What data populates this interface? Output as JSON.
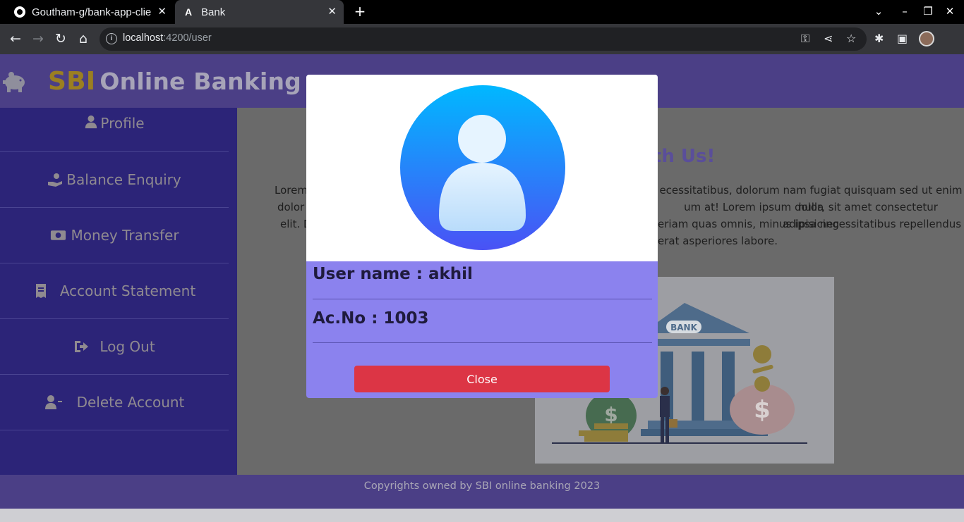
{
  "browser": {
    "tabs": [
      {
        "title": "Goutham-g/bank-app-clie",
        "close": "✕"
      },
      {
        "title": "Bank",
        "close": "✕"
      }
    ],
    "new_tab": "+",
    "url_host": "localhost",
    "url_path": ":4200/user"
  },
  "header": {
    "brand_short": "SBI",
    "brand_rest": "Online Banking"
  },
  "sidebar": {
    "items": [
      {
        "label": "Profile"
      },
      {
        "label": "Balance Enquiry"
      },
      {
        "label": "Money Transfer"
      },
      {
        "label": "Account Statement"
      },
      {
        "label": "Log Out"
      },
      {
        "label": "Delete Account"
      }
    ]
  },
  "main": {
    "welcome_visible": "ith Us!",
    "lorem_lines": [
      {
        "left": "Lorem",
        "right": "ecessitatibus, dolorum nam fugiat quisquam sed ut enim nulla"
      },
      {
        "left": "dolor",
        "right": "um at! Lorem ipsum dolor, sit amet consectetur adipisicing"
      },
      {
        "left": "elit. D",
        "right": "eriam quas omnis, minus ipsa necessitatibus repellendus"
      },
      {
        "left": "",
        "right": "erat asperiores labore."
      }
    ]
  },
  "modal": {
    "username_text": "User name : akhil",
    "account_text": "Ac.No : 1003",
    "close_label": "Close"
  },
  "footer": {
    "text": "Copyrights owned by SBI online banking 2023"
  },
  "colors": {
    "header_bg": "#4b3f86",
    "sidebar_bg": "#2c2478",
    "modal_bg": "#8b82ee",
    "close_button": "#dc3545",
    "brand_accent": "#9b7f21"
  }
}
